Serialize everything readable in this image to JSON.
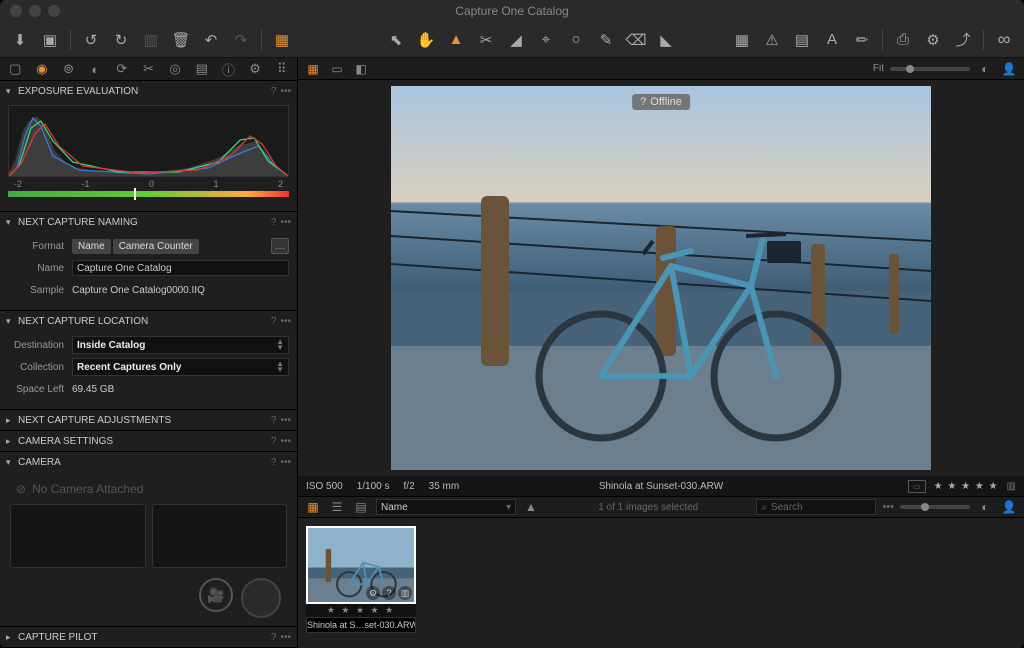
{
  "window": {
    "title": "Capture One Catalog"
  },
  "viewer": {
    "offline_badge": "Offline",
    "fit_label": "Fit",
    "meta": {
      "iso": "ISO 500",
      "shutter": "1/100 s",
      "aperture": "f/2",
      "focal": "35 mm"
    },
    "filename": "Shinola at Sunset-030.ARW",
    "stars": "★ ★ ★ ★ ★"
  },
  "browser": {
    "sort_by": "Name",
    "status": "1 of 1 images selected",
    "search_placeholder": "Search",
    "more": "•••",
    "thumb": {
      "name": "Shinola at S…set-030.ARW",
      "stars": "★ ★ ★ ★ ★"
    }
  },
  "panels": {
    "exposure": {
      "title": "EXPOSURE EVALUATION",
      "ticks": [
        "-2",
        "-1",
        "0",
        "1",
        "2"
      ]
    },
    "naming": {
      "title": "NEXT CAPTURE NAMING",
      "format_label": "Format",
      "token1": "Name",
      "token2": "Camera Counter",
      "name_label": "Name",
      "name_value": "Capture One Catalog",
      "sample_label": "Sample",
      "sample_value": "Capture One Catalog0000.IIQ"
    },
    "location": {
      "title": "NEXT CAPTURE LOCATION",
      "dest_label": "Destination",
      "dest_value": "Inside Catalog",
      "coll_label": "Collection",
      "coll_value": "Recent Captures Only",
      "space_label": "Space Left",
      "space_value": "69.45 GB"
    },
    "adjustments": {
      "title": "NEXT CAPTURE ADJUSTMENTS"
    },
    "cam_settings": {
      "title": "CAMERA SETTINGS"
    },
    "camera": {
      "title": "CAMERA",
      "no_camera": "No Camera Attached"
    },
    "pilot": {
      "title": "CAPTURE PILOT"
    }
  },
  "glyph": {
    "help": "?",
    "more": "•••"
  }
}
